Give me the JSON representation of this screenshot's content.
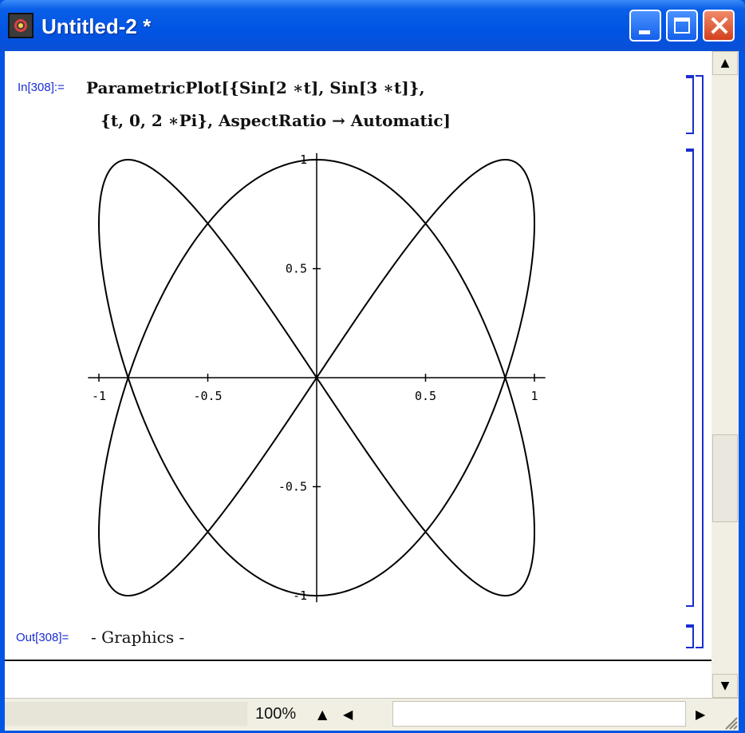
{
  "window": {
    "title": "Untitled-2 *",
    "controls": {
      "minimize": "minimize",
      "maximize": "maximize",
      "close": "close"
    }
  },
  "notebook": {
    "input_label": "In[308]:=",
    "input_line1": "ParametricPlot[{Sin[2 ∗t], Sin[3 ∗t]},",
    "input_line2": "{t, 0, 2 ∗Pi}, AspectRatio → Automatic]",
    "output_label": "Out[308]=",
    "output_text": "- Graphics -"
  },
  "chart_data": {
    "type": "line",
    "title": "",
    "xlabel": "",
    "ylabel": "",
    "curve": {
      "x": "sin(2t)",
      "y": "sin(3t)",
      "t_range": [
        0,
        6.2832
      ]
    },
    "xlim": [
      -1,
      1
    ],
    "ylim": [
      -1,
      1
    ],
    "x_ticks": [
      "-1",
      "-0.5",
      "0.5",
      "1"
    ],
    "y_ticks": [
      "1",
      "0.5",
      "-0.5",
      "-1"
    ],
    "x_tick_values": [
      -1,
      -0.5,
      0.5,
      1
    ],
    "y_tick_values": [
      1,
      0.5,
      -0.5,
      -1
    ],
    "grid": false,
    "line_color": "#000000"
  },
  "statusbar": {
    "zoom": "100%"
  },
  "icons": {
    "scroll_up": "triangle-up-icon",
    "scroll_down": "triangle-down-icon",
    "scroll_right": "triangle-right-icon",
    "zoom_up": "triangle-up-icon",
    "zoom_left": "triangle-left-icon"
  },
  "colors": {
    "titlebar": "#0054e3",
    "cell_label": "#1a2ed0",
    "close_button": "#d3401c"
  }
}
